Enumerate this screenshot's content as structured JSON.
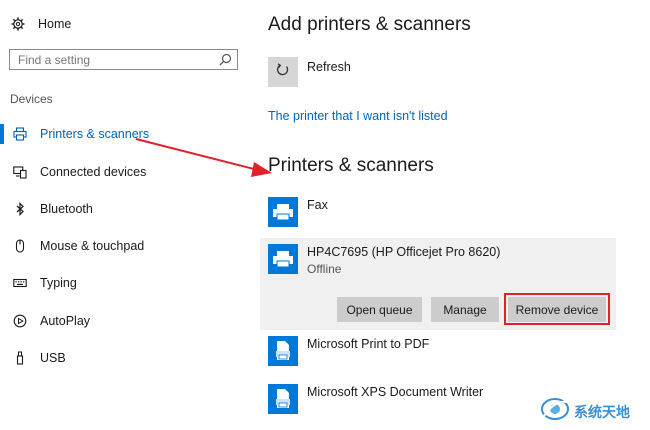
{
  "sidebar": {
    "home_label": "Home",
    "search_placeholder": "Find a setting",
    "section_label": "Devices",
    "items": [
      {
        "label": "Printers & scanners",
        "icon": "printer-icon",
        "active": true
      },
      {
        "label": "Connected devices",
        "icon": "connected-devices-icon"
      },
      {
        "label": "Bluetooth",
        "icon": "bluetooth-icon"
      },
      {
        "label": "Mouse & touchpad",
        "icon": "mouse-icon"
      },
      {
        "label": "Typing",
        "icon": "keyboard-icon"
      },
      {
        "label": "AutoPlay",
        "icon": "autoplay-icon"
      },
      {
        "label": "USB",
        "icon": "usb-icon"
      }
    ]
  },
  "main": {
    "add_title": "Add printers & scanners",
    "refresh_label": "Refresh",
    "not_listed_link": "The printer that I want isn't listed",
    "list_title": "Printers & scanners",
    "devices": [
      {
        "name": "Fax",
        "status": ""
      },
      {
        "name": "HP4C7695 (HP Officejet Pro 8620)",
        "status": "Offline",
        "selected": true
      },
      {
        "name": "Microsoft Print to PDF",
        "status": ""
      },
      {
        "name": "Microsoft XPS Document Writer",
        "status": ""
      }
    ],
    "buttons": {
      "open_queue": "Open queue",
      "manage": "Manage",
      "remove_device": "Remove device"
    }
  },
  "colors": {
    "accent": "#0078d7",
    "link": "#0067b8",
    "highlight": "#e0202a",
    "button_bg": "#cccccc"
  },
  "watermark": {
    "text": "系统天地"
  }
}
